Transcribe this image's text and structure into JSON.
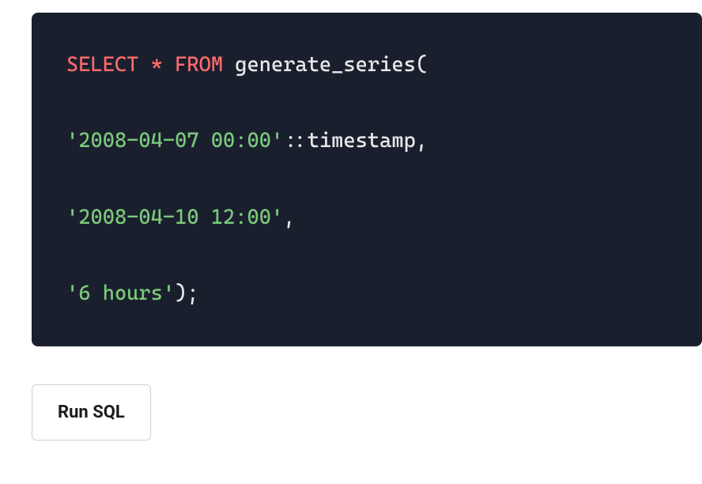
{
  "code": {
    "line1": {
      "select": "SELECT",
      "star": "*",
      "from": "FROM",
      "function": "generate_series",
      "open_paren": "("
    },
    "line2": {
      "string": "'2008-04-07 00:00'",
      "cast": "::",
      "type": "timestamp",
      "comma": ","
    },
    "line3": {
      "string": "'2008-04-10 12:00'",
      "comma": ","
    },
    "line4": {
      "string": "'6 hours'",
      "close_paren": ")",
      "semi": ";"
    }
  },
  "button": {
    "run_label": "Run SQL"
  }
}
